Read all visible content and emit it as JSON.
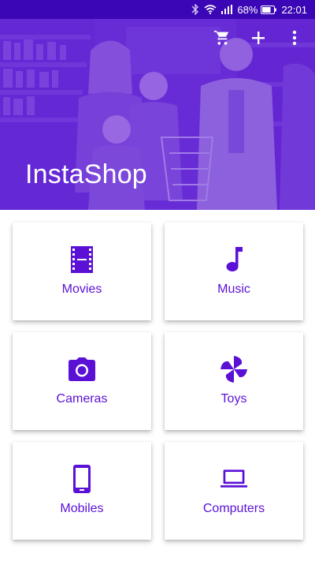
{
  "status_bar": {
    "battery_percent": "68%",
    "time": "22:01",
    "icons": [
      "bluetooth-icon",
      "wifi-icon",
      "signal-icon",
      "battery-icon"
    ]
  },
  "header": {
    "title": "InstaShop",
    "actions": [
      "cart-icon",
      "add-icon",
      "more-vert-icon"
    ]
  },
  "colors": {
    "primary": "#5a18c9",
    "status_bar": "#3b06b5",
    "accent_text": "#5b10d6"
  },
  "categories": [
    {
      "label": "Movies",
      "icon": "movie-icon"
    },
    {
      "label": "Music",
      "icon": "music-note-icon"
    },
    {
      "label": "Cameras",
      "icon": "camera-icon"
    },
    {
      "label": "Toys",
      "icon": "pinwheel-icon"
    },
    {
      "label": "Mobiles",
      "icon": "smartphone-icon"
    },
    {
      "label": "Computers",
      "icon": "laptop-icon"
    }
  ]
}
